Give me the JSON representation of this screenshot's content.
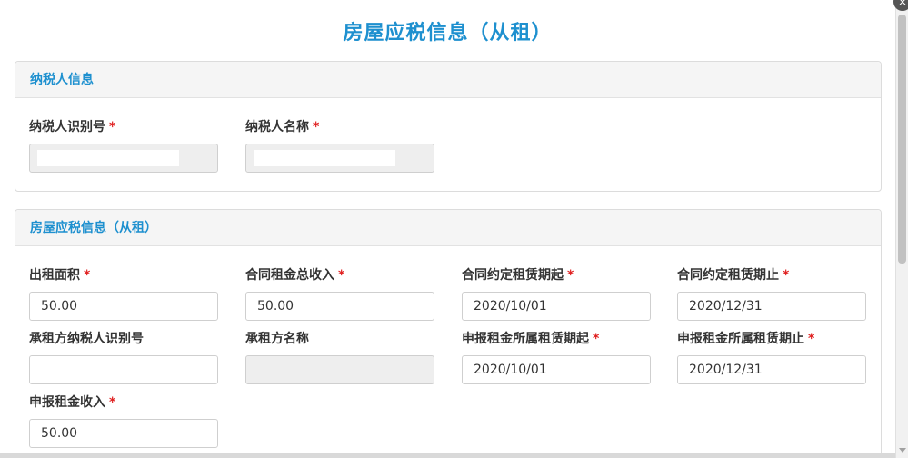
{
  "modal": {
    "title": "房屋应税信息（从租）",
    "close_glyph": "×"
  },
  "taxpayer_panel": {
    "heading": "纳税人信息",
    "fields": [
      {
        "label": "纳税人识别号",
        "required": "*",
        "value": ""
      },
      {
        "label": "纳税人名称",
        "required": "*",
        "value": ""
      }
    ]
  },
  "tax_panel": {
    "heading": "房屋应税信息（从租）",
    "fields": [
      {
        "label": "出租面积",
        "required": "*",
        "value": "50.00"
      },
      {
        "label": "合同租金总收入",
        "required": "*",
        "value": "50.00"
      },
      {
        "label": "合同约定租赁期起",
        "required": "*",
        "value": "2020/10/01"
      },
      {
        "label": "合同约定租赁期止",
        "required": "*",
        "value": "2020/12/31"
      },
      {
        "label": "承租方纳税人识别号",
        "required": "",
        "value": ""
      },
      {
        "label": "承租方名称",
        "required": "",
        "value": ""
      },
      {
        "label": "申报租金所属租赁期起",
        "required": "*",
        "value": "2020/10/01"
      },
      {
        "label": "申报租金所属租赁期止",
        "required": "*",
        "value": "2020/12/31"
      },
      {
        "label": "申报租金收入",
        "required": "*",
        "value": "50.00"
      }
    ]
  }
}
